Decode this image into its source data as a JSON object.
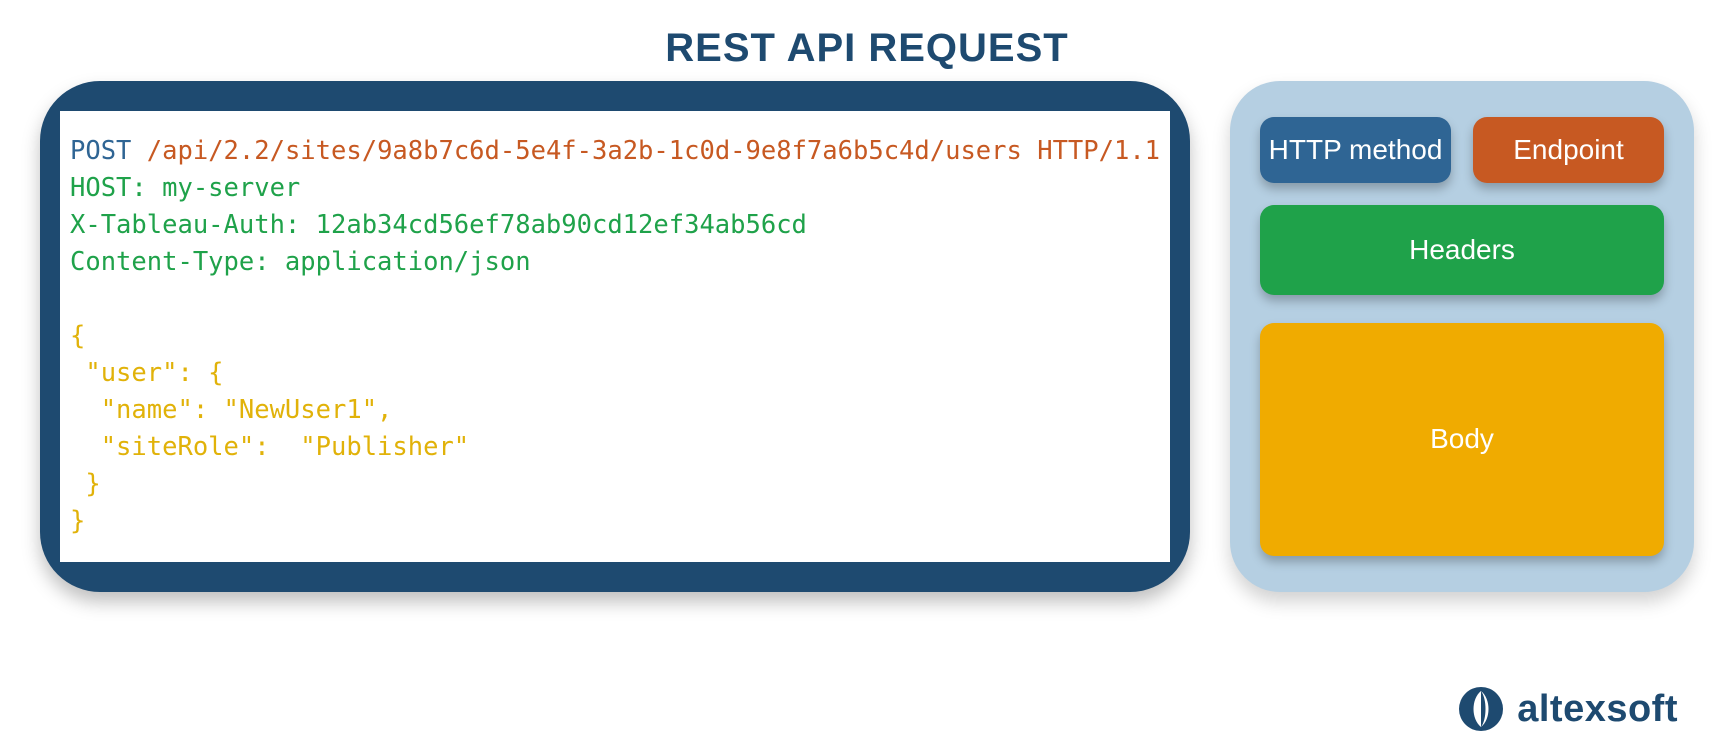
{
  "title": "REST API REQUEST",
  "request": {
    "method": "POST",
    "endpoint": "/api/2.2/sites/9a8b7c6d-5e4f-3a2b-1c0d-9e8f7a6b5c4d/users HTTP/1.1",
    "headers_text": "HOST: my-server\nX-Tableau-Auth: 12ab34cd56ef78ab90cd12ef34ab56cd\nContent-Type: application/json",
    "body_text": "{\n \"user\": {\n  \"name\": \"NewUser1\",\n  \"siteRole\":  \"Publisher\"\n }\n}"
  },
  "legend": {
    "method": "HTTP method",
    "endpoint": "Endpoint",
    "headers": "Headers",
    "body": "Body"
  },
  "brand": "altexsoft",
  "colors": {
    "method": "#2f6594",
    "endpoint": "#c75922",
    "headers": "#1fa24a",
    "body": "#f0ab00",
    "panel": "#1e4a70",
    "legend_bg": "#b5cfe2"
  }
}
